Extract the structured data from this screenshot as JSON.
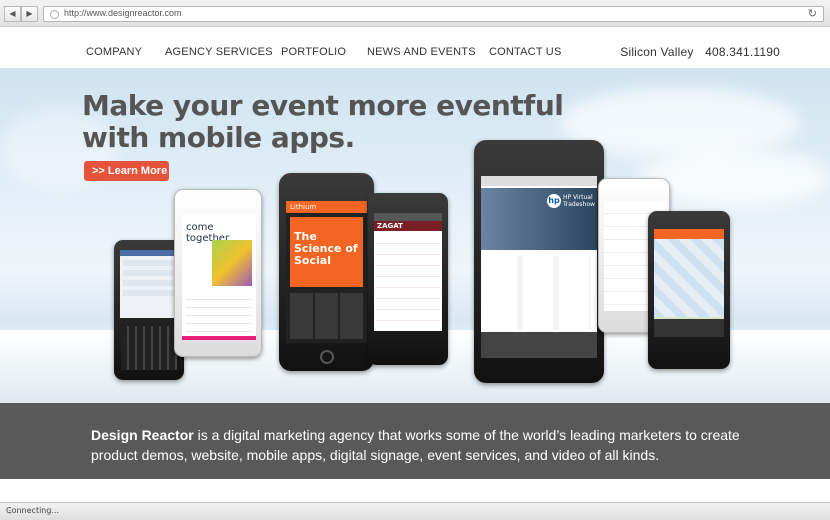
{
  "browser": {
    "back_icon": "back-arrow-icon",
    "forward_icon": "forward-arrow-icon",
    "url": "http://www.designreactor.com",
    "reload_icon": "reload-icon"
  },
  "nav": {
    "items": [
      "COMPANY",
      "AGENCY SERVICES",
      "PORTFOLIO",
      "NEWS AND EVENTS",
      "CONTACT US"
    ],
    "location": "Silicon Valley",
    "phone": "408.341.1190"
  },
  "hero": {
    "headline_line1": "Make your event more eventful",
    "headline_line2": "with mobile apps.",
    "cta_label": ">> Learn More",
    "phone_texts": {
      "come_together": "come together",
      "lithium": "Lithium",
      "science_of_social": "The Science of Social",
      "zagat": "ZAGAT",
      "hp_virtual_tradeshow": "HP Virtual Tradeshow",
      "hp_logo": "hp"
    }
  },
  "about": {
    "brand": "Design Reactor",
    "text": " is a digital marketing agency that works some of the world’s leading marketers to create product demos, website, mobile apps, digital signage, event services, and video of all kinds."
  },
  "status": {
    "text": "Connecting..."
  },
  "colors": {
    "accent": "#e4533a",
    "band": "#595959",
    "headline": "#555555"
  }
}
